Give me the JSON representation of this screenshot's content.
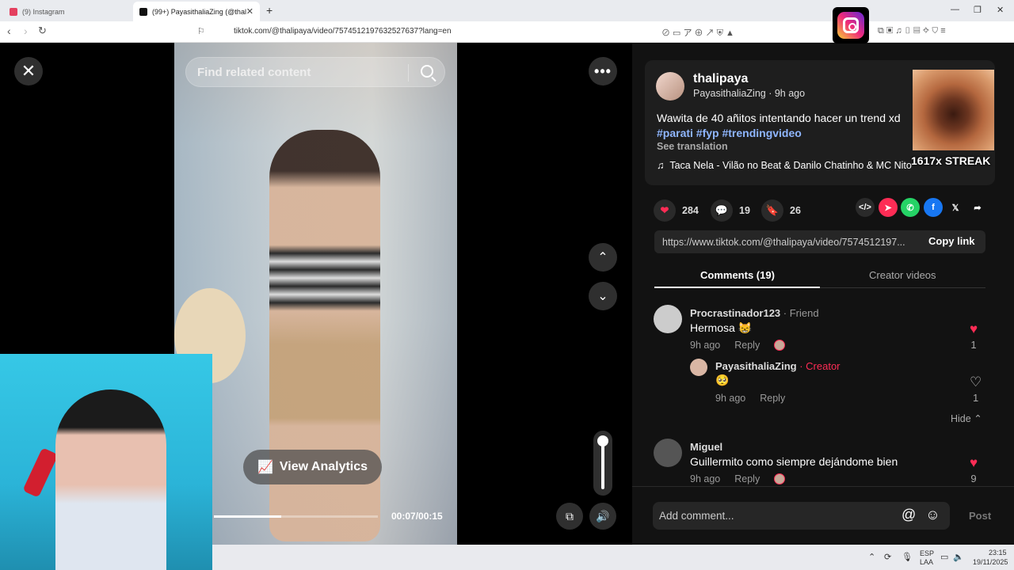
{
  "browser": {
    "tabs": [
      {
        "label": "(9) Instagram",
        "color": "#e4405f"
      },
      {
        "label": "(99+) PayasithaliaZing (@thal",
        "color": "#111111"
      }
    ],
    "url": "tiktok.com/@thalipaya/video/7574512197632527637?lang=en"
  },
  "video": {
    "search_placeholder": "Find related content",
    "analytics_label": "View Analytics",
    "time": "00:07/00:15",
    "progress_fraction": 0.41
  },
  "post": {
    "username": "thalipaya",
    "subtitle": "PayasithaliaZing · 9h ago",
    "description": "Wawita de 40 añitos intentando hacer un trend xd",
    "hashtags": "#parati #fyp #trendingvideo",
    "see_translation": "See translation",
    "music": "Taca Nela - Vilão no Beat & Danilo Chatinho & MC Nito",
    "likes": "284",
    "comments": "19",
    "saves": "26",
    "link": "https://www.tiktok.com/@thalipaya/video/7574512197...",
    "copy_link": "Copy link"
  },
  "overlay": {
    "streak": "1617x STREAK"
  },
  "panel_tabs": {
    "comments": "Comments (19)",
    "creator_videos": "Creator videos"
  },
  "comments": [
    {
      "name": "Procrastinador123",
      "tag": "Friend",
      "text": "Hermosa 😸",
      "time": "9h ago",
      "reply": "Reply",
      "likes": "1"
    },
    {
      "name": "PayasithaliaZing",
      "tag": "Creator",
      "text": "🥺",
      "time": "9h ago",
      "reply": "Reply",
      "likes": "1"
    },
    {
      "name": "Miguel",
      "tag": "",
      "text": "Guillermito como siempre dejándome bien",
      "time": "9h ago",
      "reply": "Reply",
      "likes": "9"
    }
  ],
  "hide_label": "Hide",
  "comment_input": {
    "placeholder": "Add comment...",
    "post": "Post"
  },
  "taskbar": {
    "lang": "ESP",
    "lang2": "LAA",
    "time": "23:15",
    "date": "19/11/2025"
  }
}
